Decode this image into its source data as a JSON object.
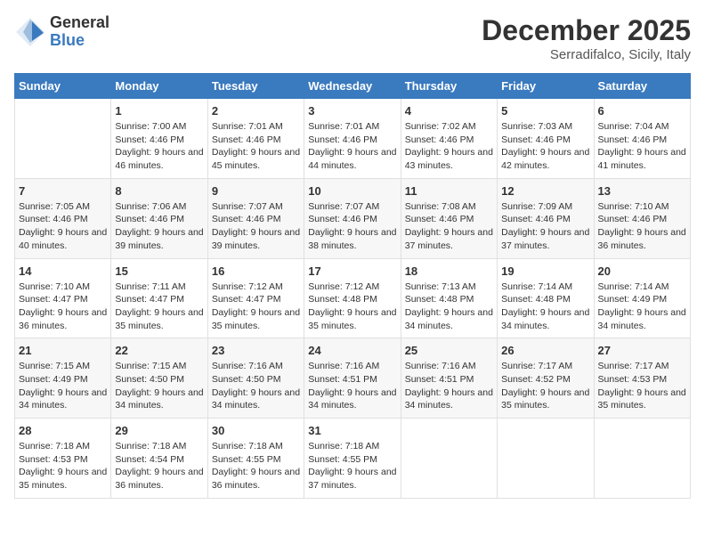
{
  "logo": {
    "general": "General",
    "blue": "Blue"
  },
  "header": {
    "month": "December 2025",
    "location": "Serradifalco, Sicily, Italy"
  },
  "days_of_week": [
    "Sunday",
    "Monday",
    "Tuesday",
    "Wednesday",
    "Thursday",
    "Friday",
    "Saturday"
  ],
  "weeks": [
    [
      {
        "day": "",
        "sunrise": "",
        "sunset": "",
        "daylight": ""
      },
      {
        "day": "1",
        "sunrise": "7:00 AM",
        "sunset": "4:46 PM",
        "daylight": "9 hours and 46 minutes."
      },
      {
        "day": "2",
        "sunrise": "7:01 AM",
        "sunset": "4:46 PM",
        "daylight": "9 hours and 45 minutes."
      },
      {
        "day": "3",
        "sunrise": "7:01 AM",
        "sunset": "4:46 PM",
        "daylight": "9 hours and 44 minutes."
      },
      {
        "day": "4",
        "sunrise": "7:02 AM",
        "sunset": "4:46 PM",
        "daylight": "9 hours and 43 minutes."
      },
      {
        "day": "5",
        "sunrise": "7:03 AM",
        "sunset": "4:46 PM",
        "daylight": "9 hours and 42 minutes."
      },
      {
        "day": "6",
        "sunrise": "7:04 AM",
        "sunset": "4:46 PM",
        "daylight": "9 hours and 41 minutes."
      }
    ],
    [
      {
        "day": "7",
        "sunrise": "7:05 AM",
        "sunset": "4:46 PM",
        "daylight": "9 hours and 40 minutes."
      },
      {
        "day": "8",
        "sunrise": "7:06 AM",
        "sunset": "4:46 PM",
        "daylight": "9 hours and 39 minutes."
      },
      {
        "day": "9",
        "sunrise": "7:07 AM",
        "sunset": "4:46 PM",
        "daylight": "9 hours and 39 minutes."
      },
      {
        "day": "10",
        "sunrise": "7:07 AM",
        "sunset": "4:46 PM",
        "daylight": "9 hours and 38 minutes."
      },
      {
        "day": "11",
        "sunrise": "7:08 AM",
        "sunset": "4:46 PM",
        "daylight": "9 hours and 37 minutes."
      },
      {
        "day": "12",
        "sunrise": "7:09 AM",
        "sunset": "4:46 PM",
        "daylight": "9 hours and 37 minutes."
      },
      {
        "day": "13",
        "sunrise": "7:10 AM",
        "sunset": "4:46 PM",
        "daylight": "9 hours and 36 minutes."
      }
    ],
    [
      {
        "day": "14",
        "sunrise": "7:10 AM",
        "sunset": "4:47 PM",
        "daylight": "9 hours and 36 minutes."
      },
      {
        "day": "15",
        "sunrise": "7:11 AM",
        "sunset": "4:47 PM",
        "daylight": "9 hours and 35 minutes."
      },
      {
        "day": "16",
        "sunrise": "7:12 AM",
        "sunset": "4:47 PM",
        "daylight": "9 hours and 35 minutes."
      },
      {
        "day": "17",
        "sunrise": "7:12 AM",
        "sunset": "4:48 PM",
        "daylight": "9 hours and 35 minutes."
      },
      {
        "day": "18",
        "sunrise": "7:13 AM",
        "sunset": "4:48 PM",
        "daylight": "9 hours and 34 minutes."
      },
      {
        "day": "19",
        "sunrise": "7:14 AM",
        "sunset": "4:48 PM",
        "daylight": "9 hours and 34 minutes."
      },
      {
        "day": "20",
        "sunrise": "7:14 AM",
        "sunset": "4:49 PM",
        "daylight": "9 hours and 34 minutes."
      }
    ],
    [
      {
        "day": "21",
        "sunrise": "7:15 AM",
        "sunset": "4:49 PM",
        "daylight": "9 hours and 34 minutes."
      },
      {
        "day": "22",
        "sunrise": "7:15 AM",
        "sunset": "4:50 PM",
        "daylight": "9 hours and 34 minutes."
      },
      {
        "day": "23",
        "sunrise": "7:16 AM",
        "sunset": "4:50 PM",
        "daylight": "9 hours and 34 minutes."
      },
      {
        "day": "24",
        "sunrise": "7:16 AM",
        "sunset": "4:51 PM",
        "daylight": "9 hours and 34 minutes."
      },
      {
        "day": "25",
        "sunrise": "7:16 AM",
        "sunset": "4:51 PM",
        "daylight": "9 hours and 34 minutes."
      },
      {
        "day": "26",
        "sunrise": "7:17 AM",
        "sunset": "4:52 PM",
        "daylight": "9 hours and 35 minutes."
      },
      {
        "day": "27",
        "sunrise": "7:17 AM",
        "sunset": "4:53 PM",
        "daylight": "9 hours and 35 minutes."
      }
    ],
    [
      {
        "day": "28",
        "sunrise": "7:18 AM",
        "sunset": "4:53 PM",
        "daylight": "9 hours and 35 minutes."
      },
      {
        "day": "29",
        "sunrise": "7:18 AM",
        "sunset": "4:54 PM",
        "daylight": "9 hours and 36 minutes."
      },
      {
        "day": "30",
        "sunrise": "7:18 AM",
        "sunset": "4:55 PM",
        "daylight": "9 hours and 36 minutes."
      },
      {
        "day": "31",
        "sunrise": "7:18 AM",
        "sunset": "4:55 PM",
        "daylight": "9 hours and 37 minutes."
      },
      {
        "day": "",
        "sunrise": "",
        "sunset": "",
        "daylight": ""
      },
      {
        "day": "",
        "sunrise": "",
        "sunset": "",
        "daylight": ""
      },
      {
        "day": "",
        "sunrise": "",
        "sunset": "",
        "daylight": ""
      }
    ]
  ]
}
